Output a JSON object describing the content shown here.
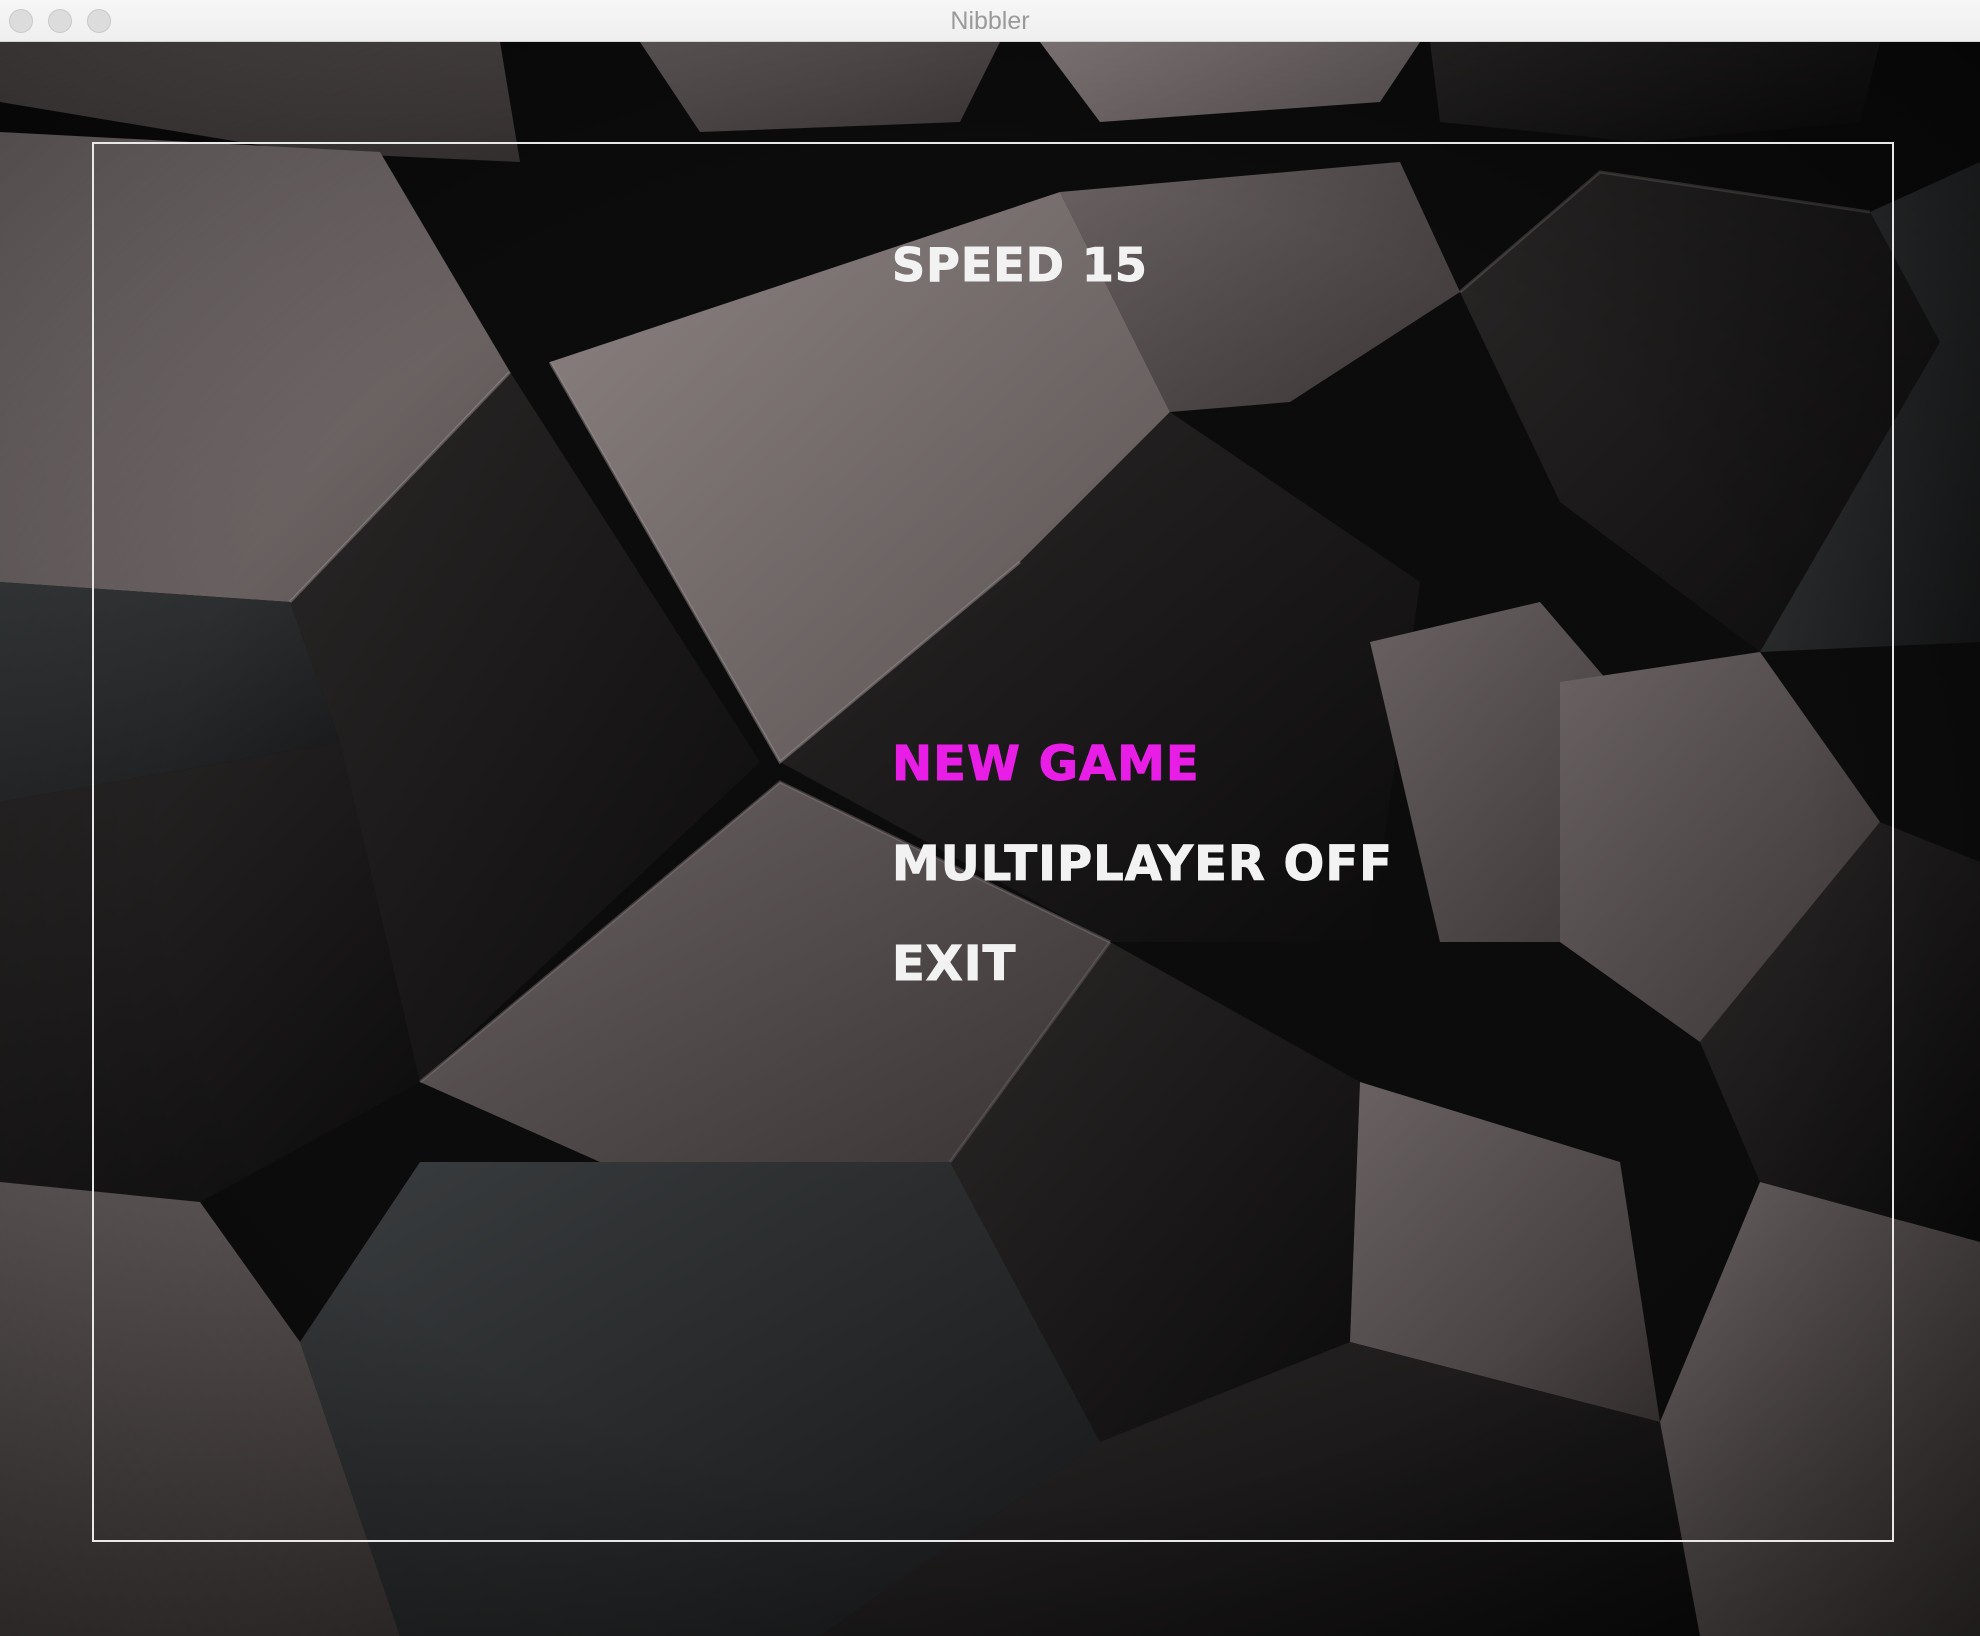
{
  "window": {
    "title": "Nibbler"
  },
  "menu": {
    "speed_label": "SPEED 15",
    "items": [
      {
        "label": "NEW GAME",
        "selected": true
      },
      {
        "label": "MULTIPLAYER OFF",
        "selected": false
      },
      {
        "label": "EXIT",
        "selected": false
      }
    ]
  },
  "colors": {
    "selected": "#e81ee6",
    "normal": "#f2f2f2",
    "frame": "#e8e8e8"
  }
}
